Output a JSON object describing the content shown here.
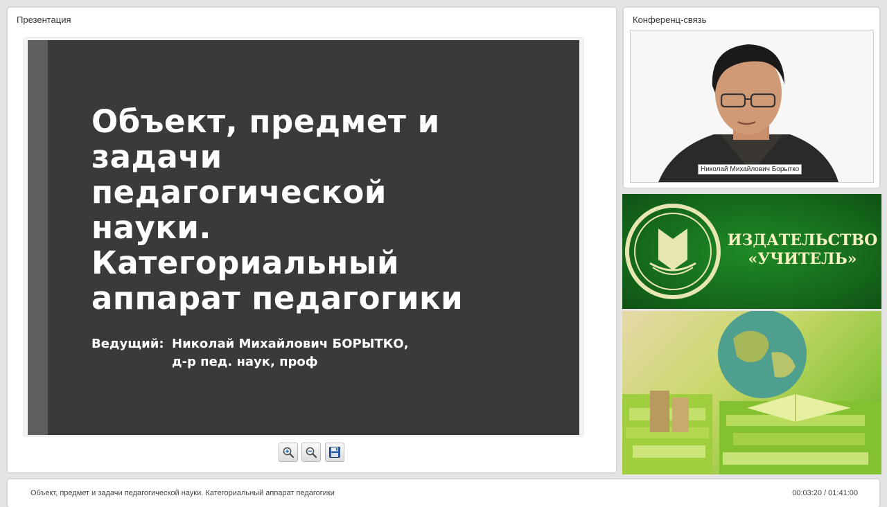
{
  "presentation": {
    "panel_title": "Презентация",
    "slide": {
      "title_lines": [
        "Объект, предмет и",
        "задачи",
        "педагогической",
        "науки.",
        "Категориальный",
        "аппарат педагогики"
      ],
      "presenter_label": "Ведущий:",
      "presenter_name": "Николай Михайлович БОРЫТКО,",
      "presenter_degree": "д-р пед. наук, проф"
    },
    "toolbar": [
      {
        "name": "zoom-in-button",
        "icon": "zoom-in-icon"
      },
      {
        "name": "zoom-out-button",
        "icon": "zoom-out-icon"
      },
      {
        "name": "save-button",
        "icon": "floppy-disk-icon"
      }
    ]
  },
  "video": {
    "panel_title": "Конференц-связь",
    "speaker_name": "Николай Михайлович Борытко"
  },
  "banners": {
    "publisher_lines": [
      "ИЗДАТЕЛЬСТВО",
      "«УЧИТЕЛЬ»"
    ]
  },
  "footer": {
    "lecture_title": "Объект, предмет и задачи педагогической науки. Категориальный аппарат педагогики",
    "time": "00:03:20 / 01:41:00"
  },
  "colors": {
    "slide_background": "#3a3a3a",
    "slide_stripe": "#5e5e5e",
    "banner_green": "#166b1c",
    "publisher_text": "#f6f2c2"
  }
}
